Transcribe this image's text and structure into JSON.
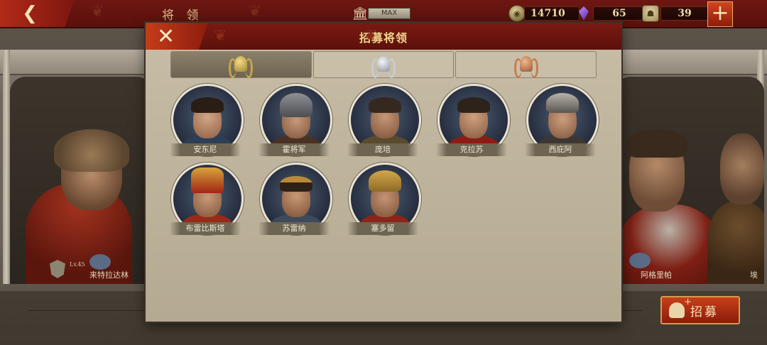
{
  "top_bar": {
    "title": "将 领",
    "museum_level": "MAX",
    "coins": "14710",
    "gems": "65",
    "soldiers": "39",
    "add_label": "+",
    "back_icon": "back-arrow-icon"
  },
  "background": {
    "left_hero": {
      "name": "来特拉达林",
      "level": "Lv.45"
    },
    "right_heroes": [
      {
        "name": "阿格里帕"
      },
      {
        "name": "埃"
      }
    ]
  },
  "recruit_button": {
    "label": "招募"
  },
  "modal": {
    "title": "招募将领",
    "close_label": "✕",
    "tabs": [
      {
        "icon": "gold-helmet-laurel-icon",
        "color": "#c9a54a",
        "active": true
      },
      {
        "icon": "silver-helmet-laurel-icon",
        "color": "#c8ccd2",
        "active": false
      },
      {
        "icon": "bronze-helmet-laurel-icon",
        "color": "#c77c4e",
        "active": false
      }
    ],
    "generals": [
      {
        "name": "安东尼"
      },
      {
        "name": "霍将军"
      },
      {
        "name": "庞培"
      },
      {
        "name": "克拉苏"
      },
      {
        "name": "西庇阿"
      },
      {
        "name": "布雷比斯塔"
      },
      {
        "name": "苏雷纳"
      },
      {
        "name": "塞多留"
      }
    ]
  }
}
